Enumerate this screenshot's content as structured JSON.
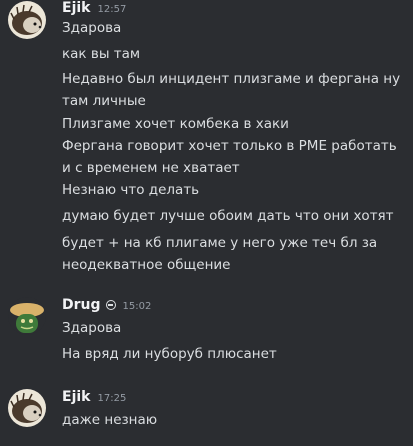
{
  "messages": [
    {
      "author": "Ejik",
      "time": "12:57",
      "avatar_icon": "hedgehog-avatar-icon",
      "lines": [
        "Здарова",
        "как вы там",
        "Недавно был инцидент плизгаме и фергана ну там личные",
        "Плизгаме хочет комбека в хаки",
        "Фергана говорит хочет только в PME работать и с временем не хватает",
        "Незнаю что делать",
        "думаю будет лучше обоим дать что они хотят",
        "будет + на кб плигаме у него уже теч бл за неодекватное общение"
      ]
    },
    {
      "author": "Drug",
      "time": "15:02",
      "avatar_icon": "mushroom-avatar-icon",
      "status_icon": "minus-circle-icon",
      "lines": [
        "Здарова",
        "На вряд ли нуборуб плюсанет"
      ]
    },
    {
      "author": "Ejik",
      "time": "17:25",
      "avatar_icon": "hedgehog-avatar-icon",
      "lines": [
        "даже незнаю"
      ]
    }
  ]
}
